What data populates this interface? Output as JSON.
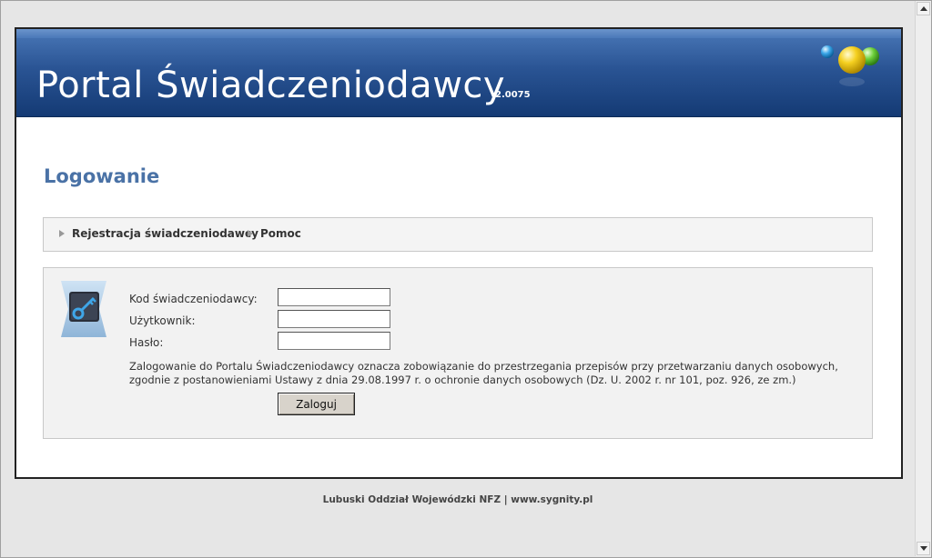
{
  "banner": {
    "title": "Portal Świadczeniodawcy",
    "version": "2.0075"
  },
  "heading": "Logowanie",
  "nav": {
    "items": [
      {
        "label": "Rejestracja świadczeniodawcy"
      },
      {
        "label": "Pomoc"
      }
    ]
  },
  "form": {
    "provider_code_label": "Kod świadczeniodawcy:",
    "provider_code_value": "",
    "user_label": "Użytkownik:",
    "user_value": "",
    "password_label": "Hasło:",
    "password_value": "",
    "notice": "Zalogowanie do Portalu Świadczeniodawcy oznacza zobowiązanie do przestrzegania przepisów przy przetwarzaniu danych osobowych, zgodnie z postanowieniami Ustawy z dnia 29.08.1997 r. o ochronie danych osobowych (Dz. U. 2002 r. nr 101, poz. 926, ze zm.)",
    "submit_label": "Zaloguj"
  },
  "footer": {
    "org": "Lubuski Oddział Wojewódzki NFZ",
    "separator": " | ",
    "link": "www.sygnity.pl"
  },
  "colors": {
    "banner": "#2a5494",
    "heading": "#4a72a6",
    "page_bg": "#e9e9e9"
  },
  "icons": {
    "logo": "colored-balls-logo",
    "login": "key-icon",
    "nav_bullet": "triangle-right-icon"
  }
}
